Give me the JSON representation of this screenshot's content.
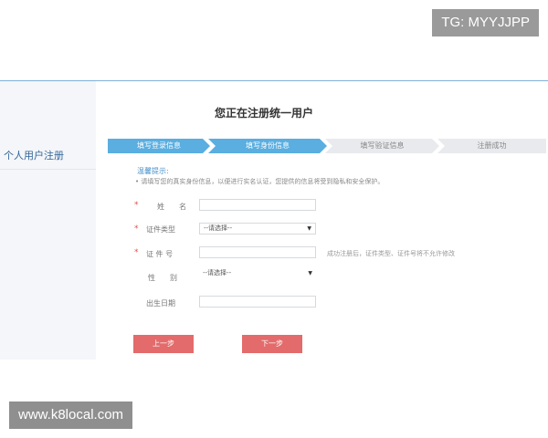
{
  "watermarks": {
    "tg": "TG: MYYJJPP",
    "url": "www.k8local.com"
  },
  "sidebar": {
    "title": "个人用户注册"
  },
  "page": {
    "title": "您正在注册统一用户"
  },
  "steps": [
    {
      "label": "填写登录信息",
      "state": "active"
    },
    {
      "label": "填写身份信息",
      "state": "active"
    },
    {
      "label": "填写验证信息",
      "state": "inactive"
    },
    {
      "label": "注册成功",
      "state": "inactive"
    }
  ],
  "tip": {
    "title": "温馨提示:",
    "text": "• 请填写您的真实身份信息，以便进行实名认证，您提供的信息将受到隐私和安全保护。"
  },
  "form": {
    "name_label": "姓　　名",
    "id_type_label": "证件类型",
    "id_type_value": "--请选择--",
    "id_number_label": "证 件 号",
    "id_number_hint": "成功注册后，证件类型、证件号将不允许修改",
    "gender_label": "性　　别",
    "gender_value": "--请选择--",
    "birthday_label": "出生日期",
    "required_mark": "*"
  },
  "buttons": {
    "prev": "上一步",
    "next": "下一步"
  },
  "colors": {
    "accent": "#5aaee0",
    "button": "#e36b6b",
    "required": "#d9534f"
  }
}
